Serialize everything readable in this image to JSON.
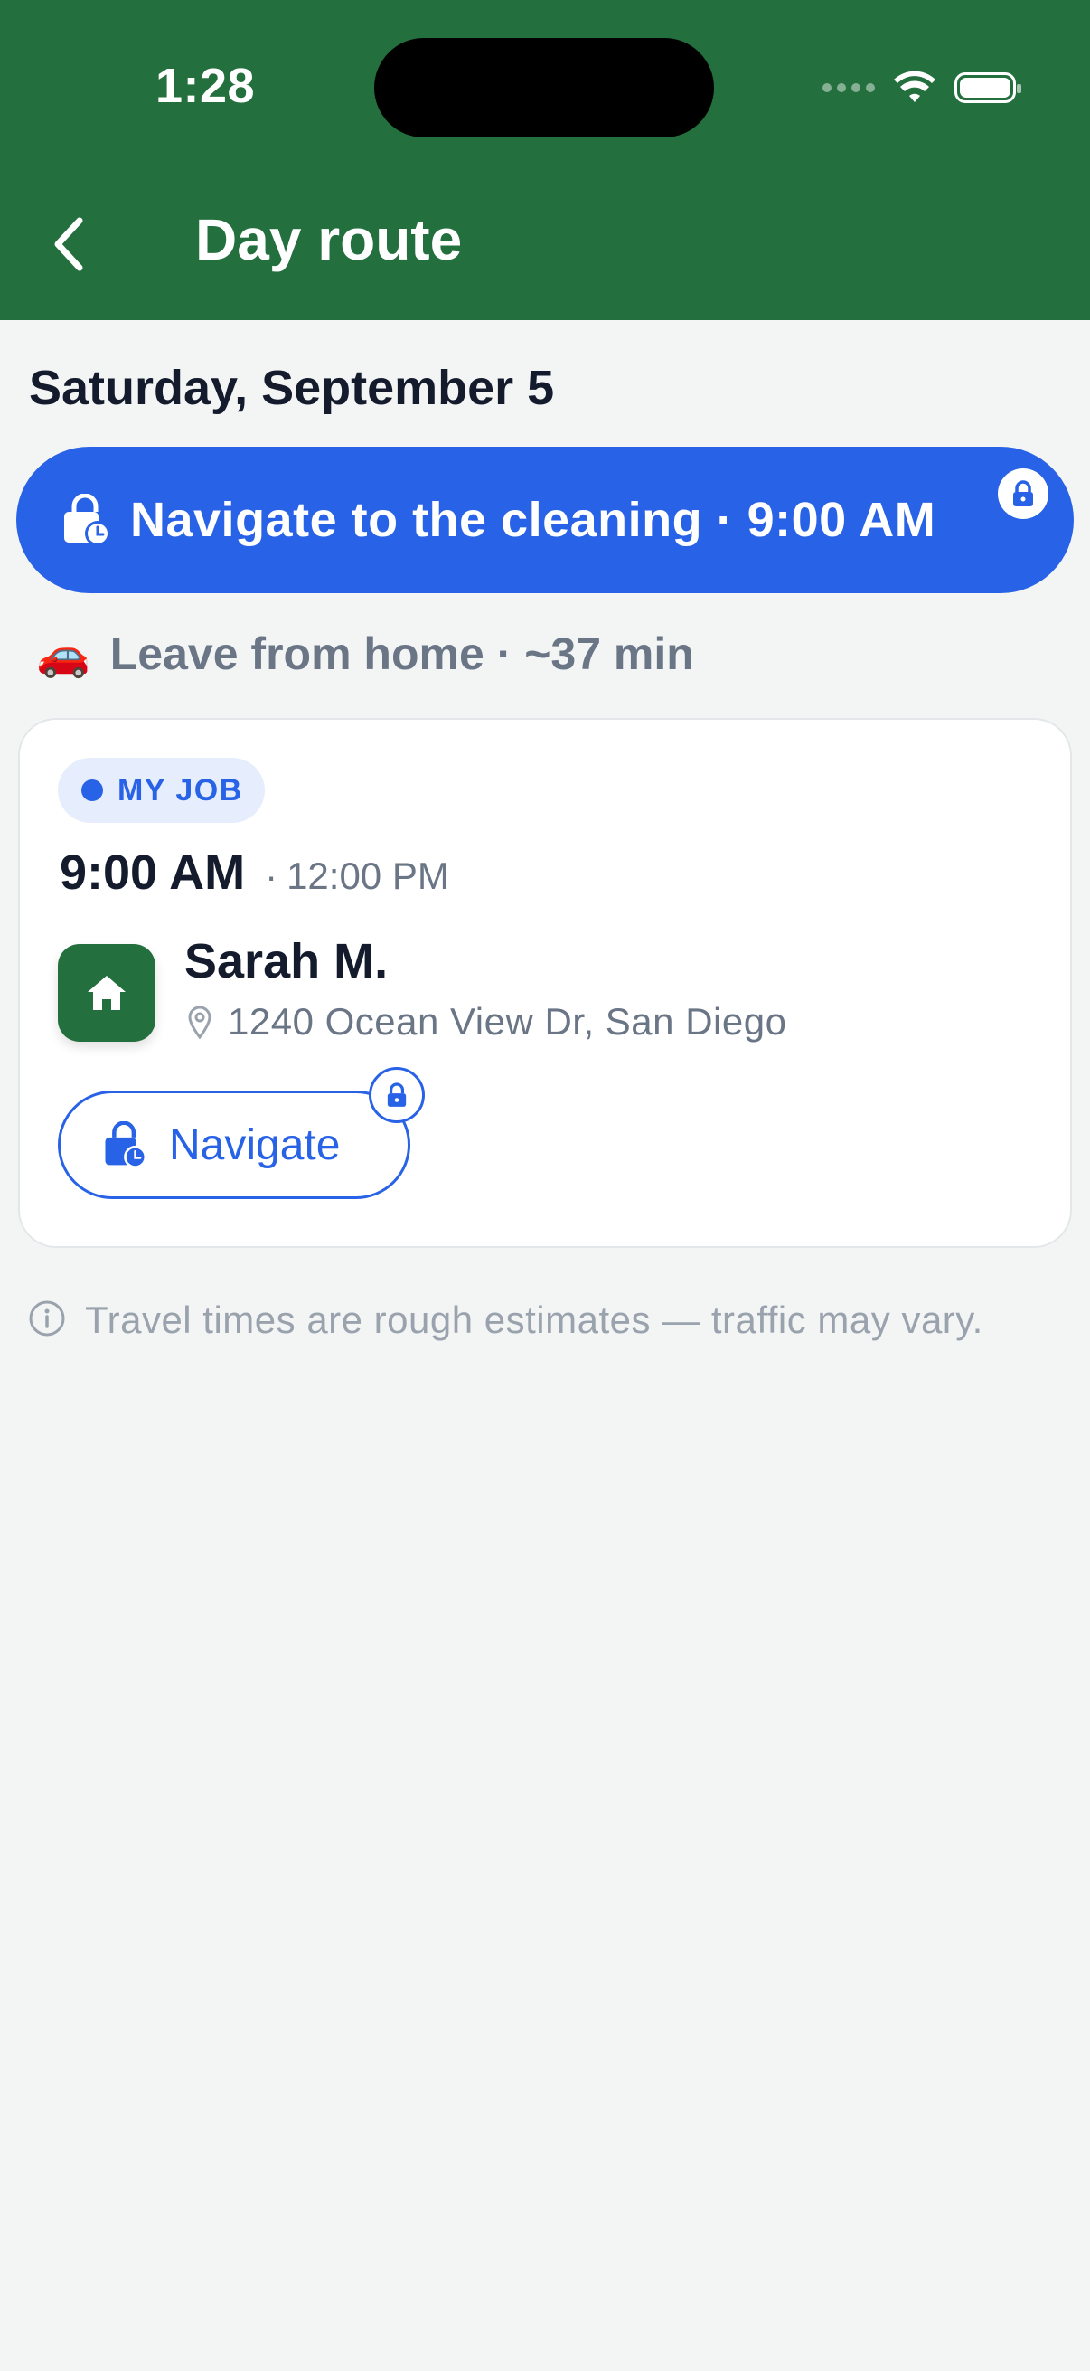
{
  "status_bar": {
    "time": "1:28"
  },
  "header": {
    "title": "Day route"
  },
  "date_heading": "Saturday, September 5",
  "nav_banner": {
    "label": "Navigate to the cleaning · 9:00 AM"
  },
  "leave": {
    "emoji": "🚗",
    "text": "Leave from home · ~37 min"
  },
  "job": {
    "badge": "MY JOB",
    "start_time": "9:00 AM",
    "separator": "·",
    "end_time": "12:00 PM",
    "client_name": "Sarah M.",
    "address": "1240 Ocean View Dr, San Diego",
    "navigate_label": "Navigate"
  },
  "note": "Travel times are rough estimates — traffic may vary.",
  "colors": {
    "header": "#236f3d",
    "accent": "#2862e6",
    "background": "#f3f5f5"
  }
}
